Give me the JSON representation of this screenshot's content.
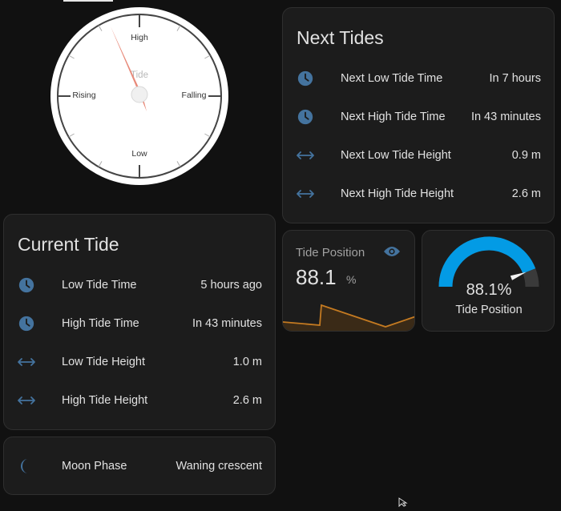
{
  "dial": {
    "title": "Tide",
    "labels": {
      "top": "High",
      "bottom": "Low",
      "left": "Rising",
      "right": "Falling"
    },
    "needle_color": "#e88a7a"
  },
  "next_tides": {
    "title": "Next Tides",
    "rows": [
      {
        "icon": "clock-icon",
        "label": "Next Low Tide Time",
        "value": "In 7 hours"
      },
      {
        "icon": "clock-icon",
        "label": "Next High Tide Time",
        "value": "In 43 minutes"
      },
      {
        "icon": "arrow-left-right-icon",
        "label": "Next Low Tide Height",
        "value": "0.9 m"
      },
      {
        "icon": "arrow-left-right-icon",
        "label": "Next High Tide Height",
        "value": "2.6 m"
      }
    ]
  },
  "current_tide": {
    "title": "Current Tide",
    "rows": [
      {
        "icon": "clock-icon",
        "label": "Low Tide Time",
        "value": "5 hours ago"
      },
      {
        "icon": "clock-icon",
        "label": "High Tide Time",
        "value": "In 43 minutes"
      },
      {
        "icon": "arrow-left-right-icon",
        "label": "Low Tide Height",
        "value": "1.0 m"
      },
      {
        "icon": "arrow-left-right-icon",
        "label": "High Tide Height",
        "value": "2.6 m"
      }
    ]
  },
  "moon": {
    "icon": "moon-crescent-icon",
    "label": "Moon Phase",
    "value": "Waning crescent"
  },
  "sensor": {
    "name": "Tide Position",
    "value": "88.1",
    "unit": "%",
    "icon": "eye-icon",
    "graph_color": "#c47a21"
  },
  "gauge": {
    "value_text": "88.1%",
    "label": "Tide Position",
    "fraction": 0.881,
    "color": "#039be5"
  },
  "colors": {
    "icon_blue": "#44739e",
    "background": "#111111",
    "card": "#1c1c1c"
  }
}
